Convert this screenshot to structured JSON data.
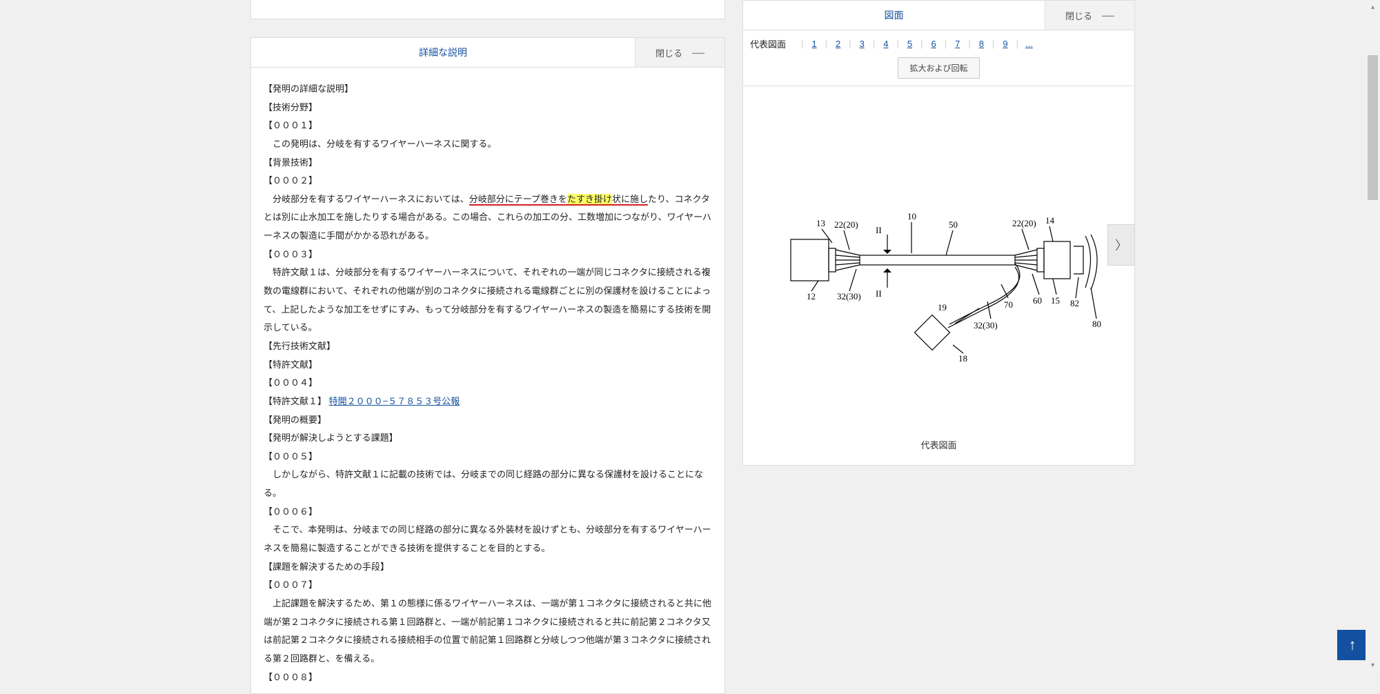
{
  "leftPanel": {
    "headerTitle": "詳細な説明",
    "closeLabel": "閉じる",
    "paragraphs": {
      "p01": "【発明の詳細な説明】",
      "p02": "【技術分野】",
      "p03": "【０００１】",
      "p04": "　この発明は、分岐を有するワイヤーハーネスに関する。",
      "p05": "【背景技術】",
      "p06": "【０００２】",
      "p07a": "　分岐部分を有するワイヤーハーネスにおいては、",
      "p07b": "分岐部分にテープ巻きを",
      "p07c": "たすき掛け",
      "p07d": "状に施し",
      "p07e": "たり、コネクタとは別に止水加工を施したりする場合がある。この場合、これらの加工の分、工数増加につながり、ワイヤーハーネスの製造に手間がかかる恐れがある。",
      "p08": "【０００３】",
      "p09": "　特許文献１は、分岐部分を有するワイヤーハーネスについて、それぞれの一端が同じコネクタに接続される複数の電線群において、それぞれの他端が別のコネクタに接続される電線群ごとに別の保護材を設けることによって、上記したような加工をせずにすみ、もって分岐部分を有するワイヤーハーネスの製造を簡易にする技術を開示している。",
      "p10": "【先行技術文献】",
      "p11": "【特許文献】",
      "p12": "【０００４】",
      "p13a": "【特許文献１】",
      "p13link": "特開２０００−５７８５３号公報",
      "p14": "【発明の概要】",
      "p15": "【発明が解決しようとする課題】",
      "p16": "【０００５】",
      "p17": "　しかしながら、特許文献１に記載の技術では、分岐までの同じ経路の部分に異なる保護材を設けることになる。",
      "p18": "【０００６】",
      "p19": "　そこで、本発明は、分岐までの同じ経路の部分に異なる外装材を設けずとも、分岐部分を有するワイヤーハーネスを簡易に製造することができる技術を提供することを目的とする。",
      "p20": "【課題を解決するための手段】",
      "p21": "【０００７】",
      "p22": "　上記課題を解決するため、第１の態様に係るワイヤーハーネスは、一端が第１コネクタに接続されると共に他端が第２コネクタに接続される第１回路群と、一端が前記第１コネクタに接続されると共に前記第２コネクタ又は前記第２コネクタに接続される接続相手の位置で前記第１回路群と分岐しつつ他端が第３コネクタに接続される第２回路群と、を備える。",
      "p23": "【０００８】"
    }
  },
  "rightPanel": {
    "headerTitle": "図面",
    "closeLabel": "閉じる",
    "navLabel": "代表図面",
    "navNumbers": [
      "1",
      "2",
      "3",
      "4",
      "5",
      "6",
      "7",
      "8",
      "9"
    ],
    "navDots": "...",
    "expandLabel": "拡大および回転",
    "caption": "代表図面",
    "diagram": {
      "labels": {
        "l13": "13",
        "l12": "12",
        "l22_20_L": "22(20)",
        "l32_30_L": "32(30)",
        "II1": "II",
        "II2": "II",
        "l10": "10",
        "l50": "50",
        "l19": "19",
        "l70": "70",
        "l32_30_R": "32(30)",
        "l18": "18",
        "l60": "60",
        "l22_20_R": "22(20)",
        "l14": "14",
        "l15": "15",
        "l82": "82",
        "l80": "80"
      }
    }
  },
  "backToTop": "↑"
}
